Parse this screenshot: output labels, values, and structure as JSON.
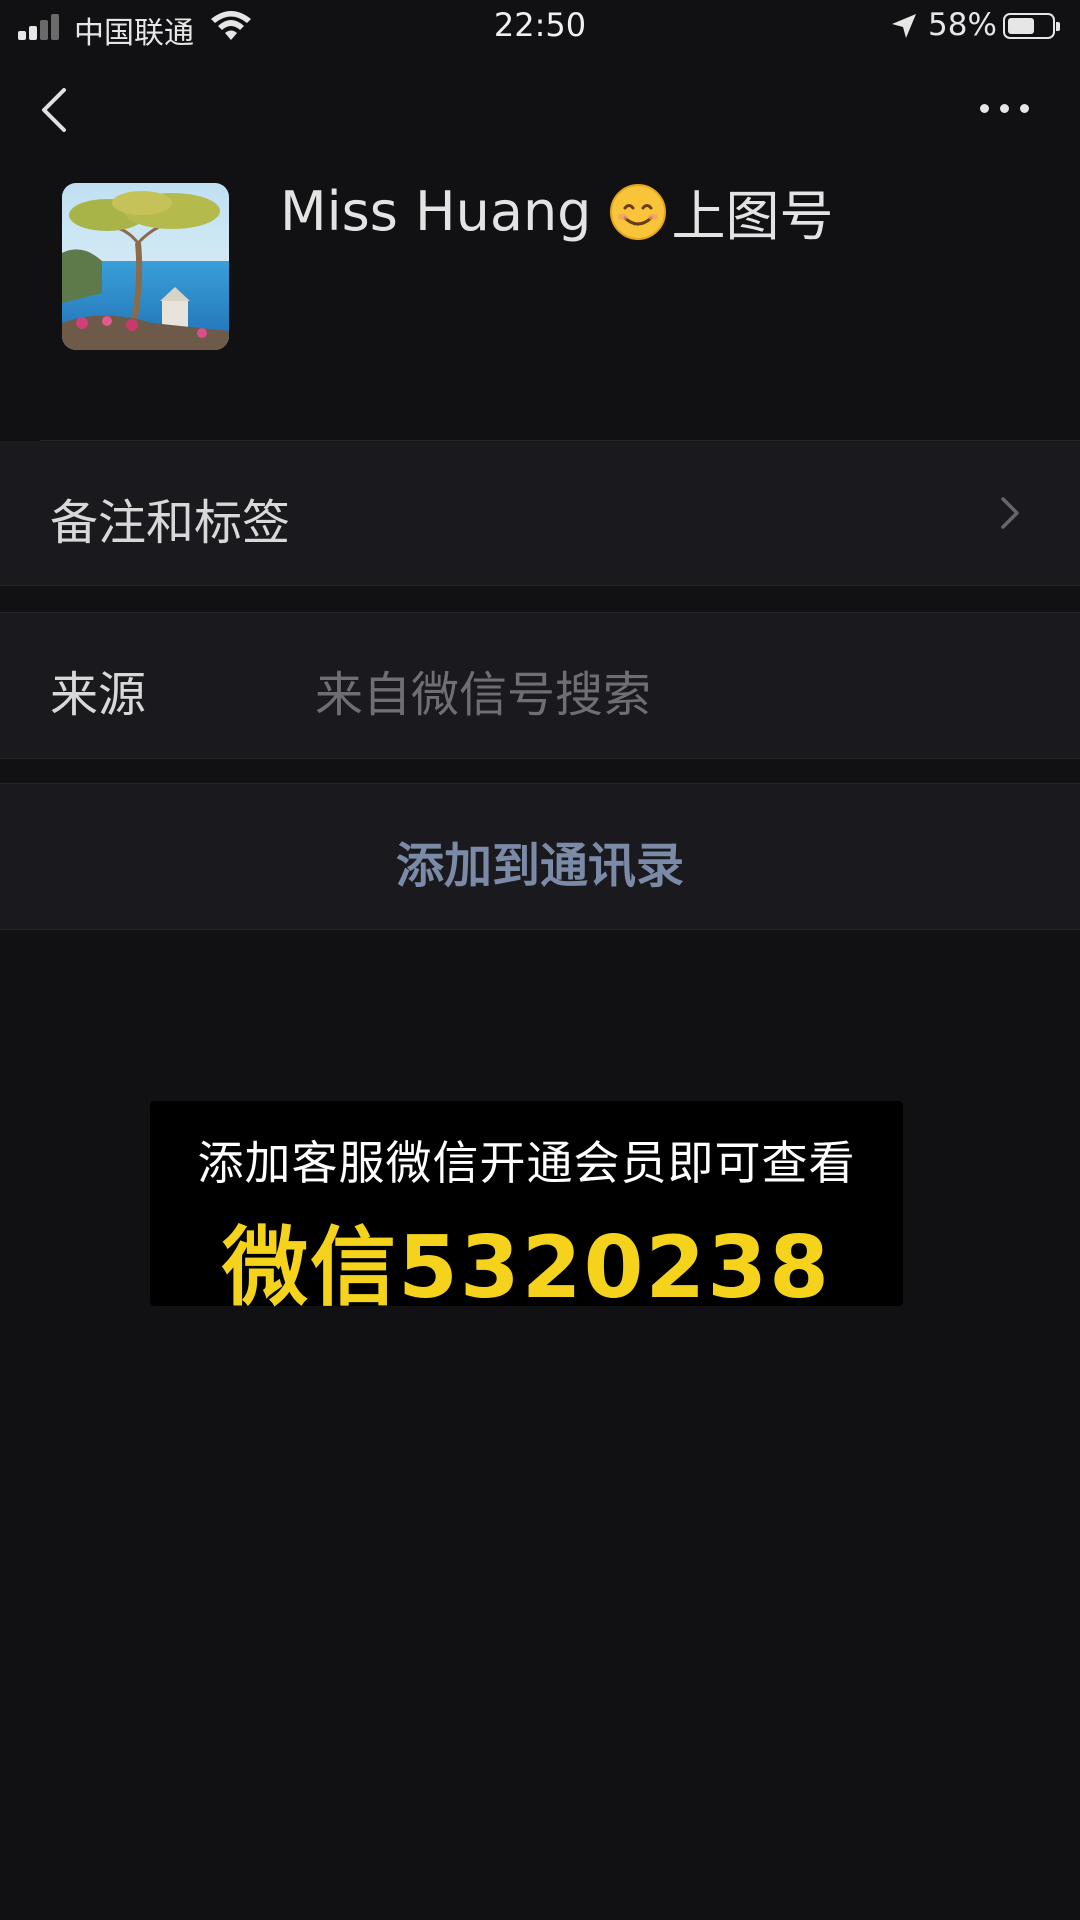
{
  "status_bar": {
    "carrier": "中国联通",
    "time": "22:50",
    "battery_percent": "58%",
    "battery_level": 0.58
  },
  "nav": {
    "back_icon": "chevron-left-icon",
    "more_icon": "more-dots-icon"
  },
  "profile": {
    "name": "Miss Huang",
    "name_suffix": "上图号",
    "emoji_icon": "smiling-face-icon"
  },
  "rows": {
    "remark_label": "备注和标签",
    "source_label": "来源",
    "source_value": "来自微信号搜索",
    "add_contact_label": "添加到通讯录"
  },
  "promo": {
    "line1": "添加客服微信开通会员即可查看",
    "line2": "微信5320238",
    "highlight_color": "#f5d31c"
  }
}
